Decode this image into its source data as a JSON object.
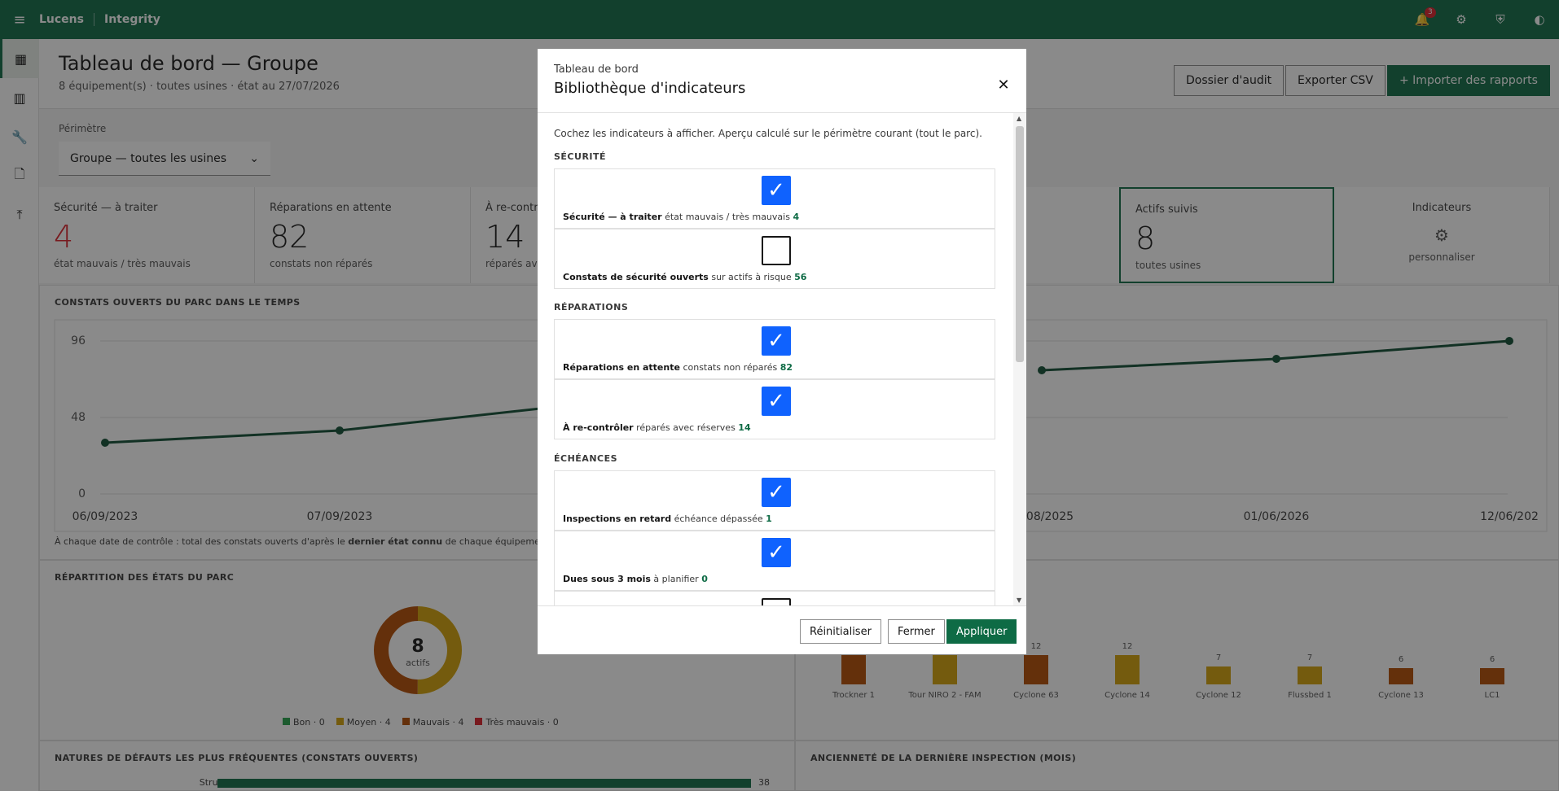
{
  "app": {
    "brand": "Lucens",
    "product": "Integrity",
    "notifications": "3"
  },
  "header": {
    "title": "Tableau de bord — Groupe",
    "subtitle": "8 équipement(s) · toutes usines · état au 27/07/2026",
    "btn_audit": "Dossier d'audit",
    "btn_export": "Exporter CSV",
    "btn_import": "+ Importer des rapports"
  },
  "perimeter": {
    "label": "Périmètre",
    "value": "Groupe — toutes les usines"
  },
  "kpis": [
    {
      "title": "Sécurité — à traiter",
      "value": "4",
      "sub": "état mauvais / très mauvais"
    },
    {
      "title": "Réparations en attente",
      "value": "82",
      "sub": "constats non réparés"
    },
    {
      "title": "À re-contrô",
      "value": "14",
      "sub": "réparés avec"
    },
    {
      "title": "Actifs suivis",
      "value": "8",
      "sub": "toutes usines"
    },
    {
      "title": "Indicateurs",
      "sub": "personnaliser"
    }
  ],
  "timeline": {
    "title": "CONSTATS OUVERTS DU PARC DANS LE TEMPS",
    "y_ticks": [
      "96",
      "48",
      "0"
    ],
    "x_left": [
      "06/09/2023",
      "07/09/2023"
    ],
    "x_right": [
      "08/2025",
      "01/06/2026",
      "12/06/202"
    ],
    "note_a": "À chaque date de contrôle : total des constats ouverts d'après le ",
    "note_b": "dernier état connu",
    "note_c": " de chaque équipement. Un équipem"
  },
  "etat": {
    "title": "RÉPARTITION DES ÉTATS DU PARC",
    "center_value": "8",
    "center_label": "actifs",
    "legend": [
      {
        "label": "Bon · 0",
        "color": "#24a148"
      },
      {
        "label": "Moyen · 4",
        "color": "#d2a106"
      },
      {
        "label": "Mauvais · 4",
        "color": "#b34a00"
      },
      {
        "label": "Très mauvais · 0",
        "color": "#da1e28"
      }
    ]
  },
  "bars": {
    "categories": [
      "Trockner 1",
      "Tour NIRO 2 - FAM",
      "Cyclone 63",
      "Cyclone 14",
      "Cyclone 12",
      "Flussbed 1",
      "Cyclone 13",
      "LC1"
    ],
    "values": [
      "",
      "",
      "12",
      "12",
      "7",
      "7",
      "6",
      "6"
    ]
  },
  "natures": {
    "title": "NATURES DE DÉFAUTS LES PLUS FRÉQUENTES (CONSTATS OUVERTS)",
    "row_label": "Structurel",
    "row_value": "38"
  },
  "anciennete": {
    "title": "ANCIENNETÉ DE LA DERNIÈRE INSPECTION (MOIS)"
  },
  "modal": {
    "label": "Tableau de bord",
    "title": "Bibliothèque d'indicateurs",
    "intro": "Cochez les indicateurs à afficher. Aperçu calculé sur le périmètre courant (tout le parc).",
    "groups": [
      "SÉCURITÉ",
      "RÉPARATIONS",
      "ÉCHÉANCES"
    ],
    "rows": [
      {
        "name": "Sécurité — à traiter",
        "desc": " état mauvais / très mauvais ",
        "value": "4"
      },
      {
        "name": "Constats de sécurité ouverts",
        "desc": " sur actifs à risque ",
        "value": "56"
      },
      {
        "name": "Réparations en attente",
        "desc": " constats non réparés ",
        "value": "82"
      },
      {
        "name": "À re-contrôler",
        "desc": " réparés avec réserves ",
        "value": "14"
      },
      {
        "name": "Inspections en retard",
        "desc": " échéance dépassée ",
        "value": "1"
      },
      {
        "name": "Dues sous 3 mois",
        "desc": " à planifier ",
        "value": "0"
      }
    ],
    "btn_reset": "Réinitialiser",
    "btn_close": "Fermer",
    "btn_apply": "Appliquer"
  }
}
